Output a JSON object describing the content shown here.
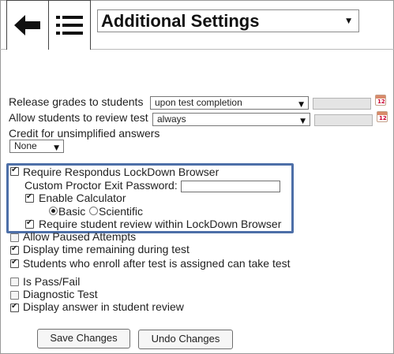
{
  "header": {
    "title": "Additional Settings",
    "back_icon": "back-arrow-icon",
    "menu_icon": "list-menu-icon"
  },
  "release_grades": {
    "label": "Release grades to students",
    "value": "upon test completion"
  },
  "review_test": {
    "label": "Allow students to review test",
    "value": "always"
  },
  "credit": {
    "label": "Credit for unsimplified answers",
    "value": "None"
  },
  "lockdown": {
    "require_label": "Require Respondus LockDown Browser",
    "require_checked": true,
    "password_label": "Custom Proctor Exit Password:",
    "password_value": "",
    "calculator_label": "Enable Calculator",
    "calculator_checked": true,
    "basic_label": "Basic",
    "scientific_label": "Scientific",
    "selected_calculator": "Basic",
    "review_label": "Require student review within LockDown Browser",
    "review_checked": true
  },
  "options": [
    {
      "label": "Allow Paused Attempts",
      "checked": false
    },
    {
      "label": "Display time remaining during test",
      "checked": true
    },
    {
      "label": "Students who enroll after test is assigned can take test",
      "checked": true
    },
    {
      "label": "Is Pass/Fail",
      "checked": false
    },
    {
      "label": "Diagnostic Test",
      "checked": false
    },
    {
      "label": "Display answer in student review",
      "checked": true
    }
  ],
  "buttons": {
    "save": "Save Changes",
    "undo": "Undo Changes"
  },
  "colors": {
    "highlight_border": "#4d6fa8"
  }
}
